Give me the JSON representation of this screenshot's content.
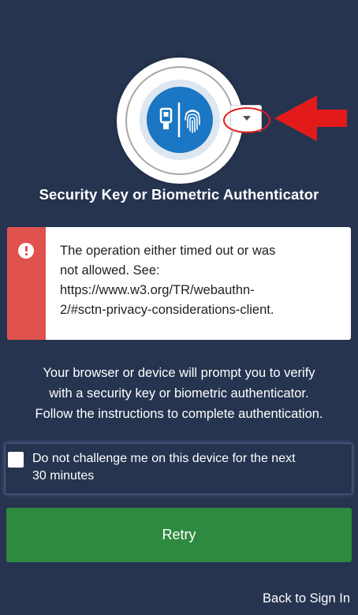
{
  "icons": {
    "authenticator": "security-key-fingerprint-icon",
    "dropdown": "chevron-down-icon",
    "error": "exclamation-icon",
    "annotation_arrow": "red-arrow-icon"
  },
  "colors": {
    "background": "#263450",
    "error_accent": "#e0524d",
    "retry_button": "#2e8a3e",
    "badge_blue": "#1b76c3",
    "annotation_red": "#e31a1a"
  },
  "header": {
    "title": "Security Key or Biometric Authenticator"
  },
  "error": {
    "message": "The operation either timed out or was\nnot allowed. See:\nhttps://www.w3.org/TR/webauthn-\n2/#sctn-privacy-considerations-client."
  },
  "instructions": {
    "text": "Your browser or device will prompt you to verify\nwith a security key or biometric authenticator.\nFollow the instructions to complete authentication."
  },
  "remember": {
    "label": "Do not challenge me on this device for the next\n30 minutes",
    "checked": false
  },
  "actions": {
    "retry_label": "Retry",
    "back_label": "Back to Sign In"
  }
}
